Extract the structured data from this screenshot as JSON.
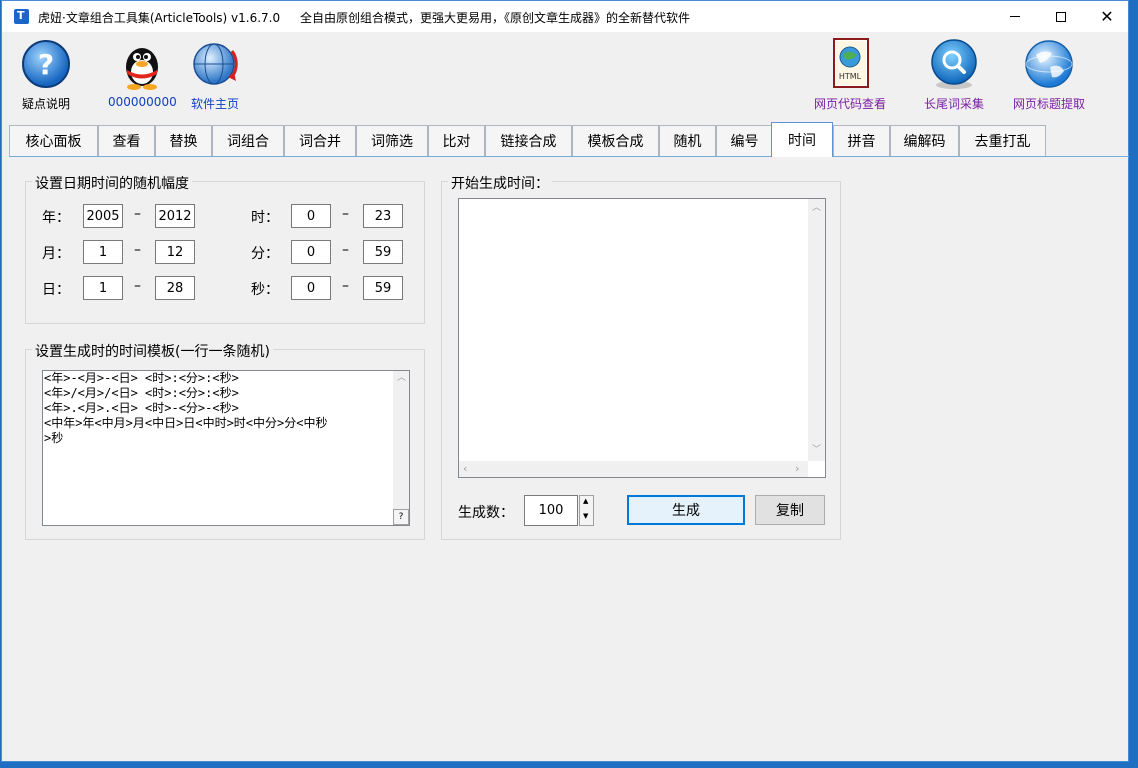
{
  "window": {
    "title": "虎妞·文章组合工具集(ArticleTools) v1.6.7.0",
    "slogan": "全自由原创组合模式，更强大更易用，《原创文章生成器》的全新替代软件"
  },
  "toolbar": {
    "left": [
      {
        "label": "疑点说明",
        "icon": "help-icon"
      },
      {
        "label": "000000000",
        "icon": "qq-penguin-icon"
      },
      {
        "label": "软件主页",
        "icon": "globe-icon"
      }
    ],
    "right": [
      {
        "label": "网页代码查看",
        "icon": "html-file-icon"
      },
      {
        "label": "长尾词采集",
        "icon": "search-icon"
      },
      {
        "label": "网页标题提取",
        "icon": "web-globe-icon"
      }
    ]
  },
  "tabs": [
    "核心面板",
    "查看",
    "替换",
    "词组合",
    "词合并",
    "词筛选",
    "比对",
    "链接合成",
    "模板合成",
    "随机",
    "编号",
    "时间",
    "拼音",
    "编解码",
    "去重打乱"
  ],
  "active_tab": "时间",
  "range_group": {
    "title": "设置日期时间的随机幅度",
    "dash": "–",
    "rows": [
      {
        "label": "年：",
        "from": "2005",
        "to": "2012"
      },
      {
        "label": "月：",
        "from": "1",
        "to": "12"
      },
      {
        "label": "日：",
        "from": "1",
        "to": "28"
      },
      {
        "label": "时：",
        "from": "0",
        "to": "23"
      },
      {
        "label": "分：",
        "from": "0",
        "to": "59"
      },
      {
        "label": "秒：",
        "from": "0",
        "to": "59"
      }
    ]
  },
  "template_group": {
    "title": "设置生成时的时间模板(一行一条随机)",
    "text": "<年>-<月>-<日> <时>:<分>:<秒>\n<年>/<月>/<日> <时>:<分>:<秒>\n<年>.<月>.<日> <时>-<分>-<秒>\n<中年>年<中月>月<中日>日<中时>时<中分>分<中秒\n>秒",
    "help_glyph": "?"
  },
  "output_group": {
    "title": "开始生成时间：",
    "count_label": "生成数：",
    "count_value": "100",
    "generate_label": "生成",
    "copy_label": "复制"
  }
}
